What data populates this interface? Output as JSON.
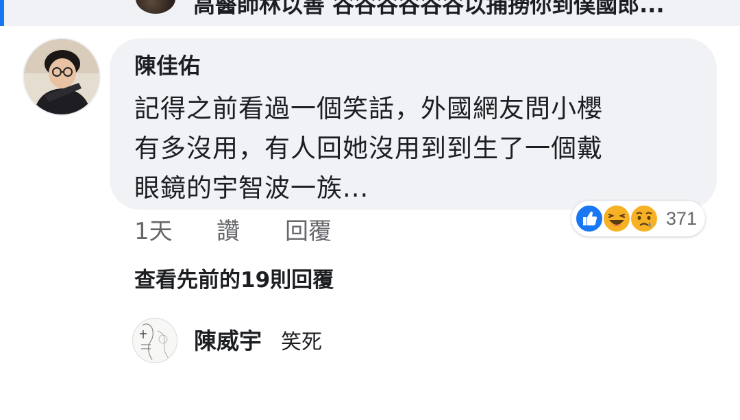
{
  "top_comment": {
    "text": "高醫師林以善 谷谷谷谷谷谷以捕撈你到僕國郎..."
  },
  "comment": {
    "author": "陳佳佑",
    "lines": [
      "記得之前看過一個笑話，外國網友問小櫻",
      "有多沒用，有人回她沒用到到生了一個戴",
      "眼鏡的宇智波一族..."
    ],
    "time": "1天",
    "like_label": "讚",
    "reply_label": "回覆",
    "reactions": {
      "icons": [
        "like-icon",
        "haha-icon",
        "sad-icon"
      ],
      "count": "371",
      "colors": {
        "like": "#1877f2",
        "haha": "#f7b125",
        "sad": "#f7b125"
      }
    }
  },
  "view_previous_replies": "查看先前的19則回覆",
  "reply": {
    "author": "陳威宇",
    "text": "笑死"
  }
}
